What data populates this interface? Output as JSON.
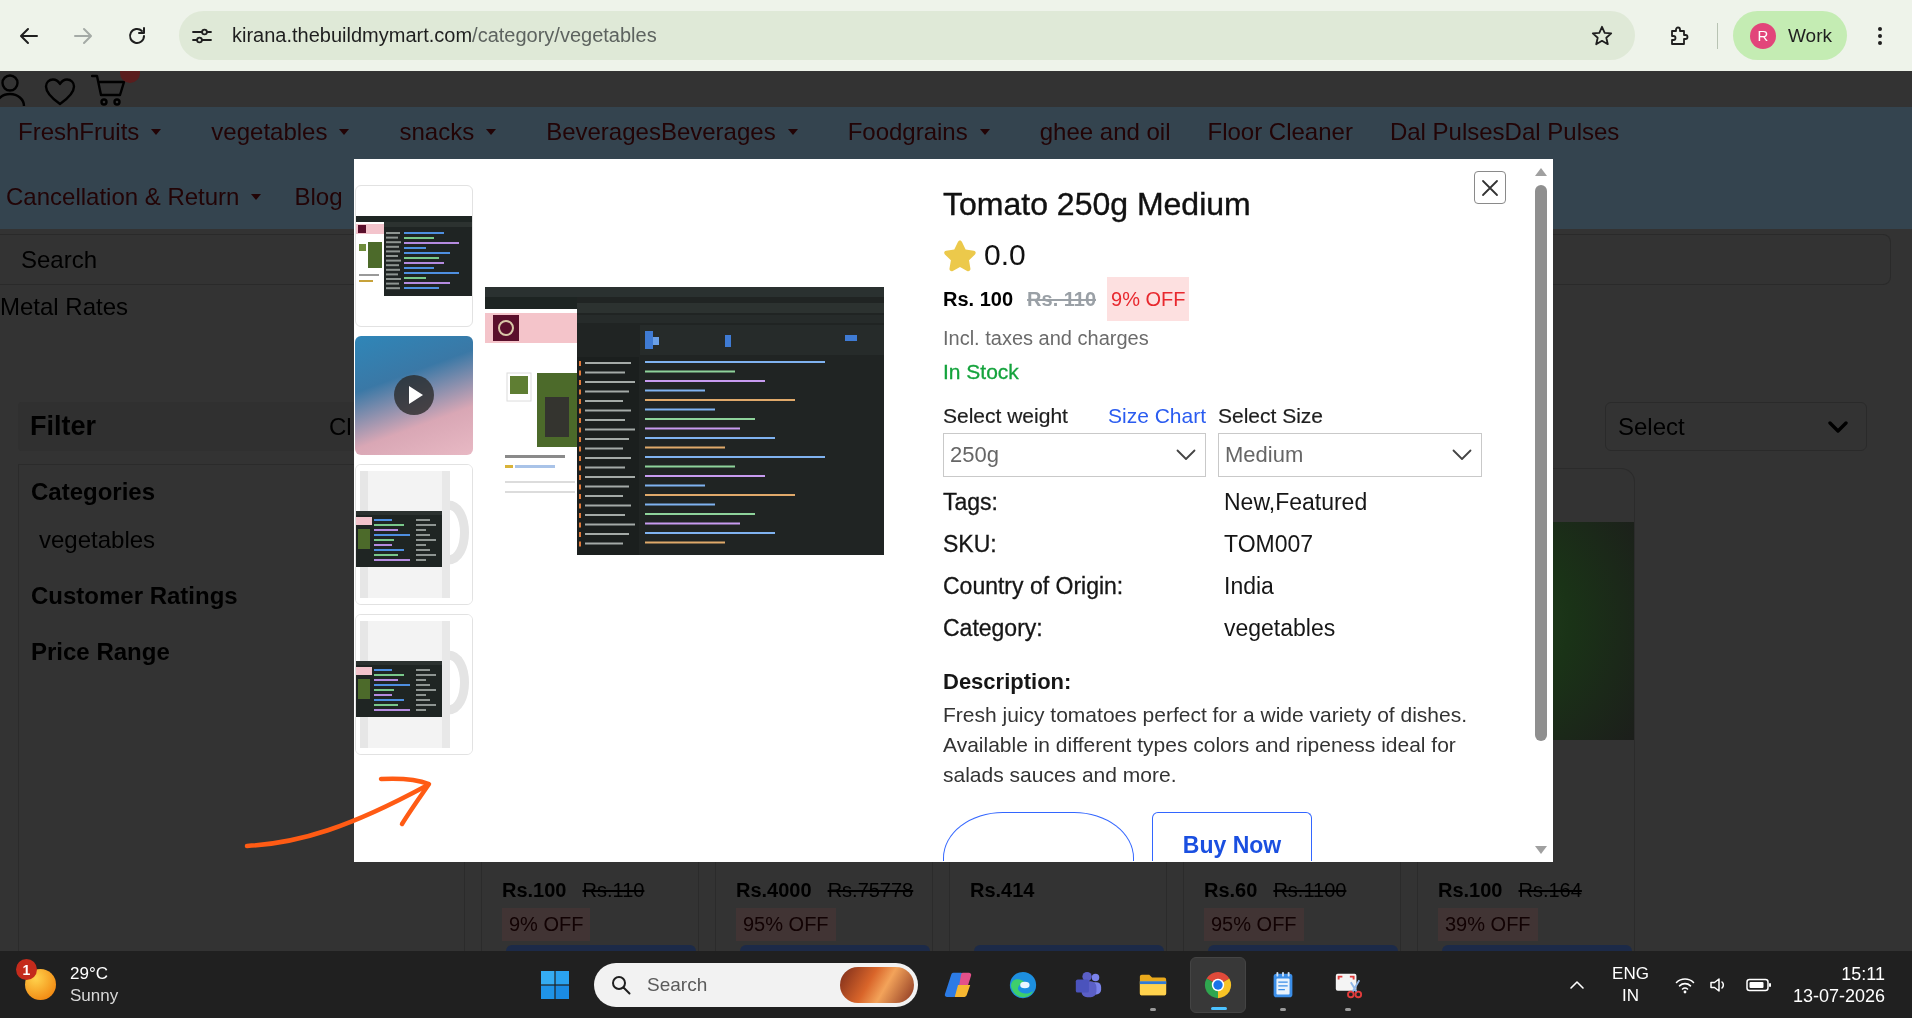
{
  "browser": {
    "nav_buttons": [
      {
        "kind": "back",
        "disabled": false
      },
      {
        "kind": "forward",
        "disabled": true
      },
      {
        "kind": "reload",
        "disabled": false
      }
    ],
    "address": {
      "host": "kirana.thebuildmymart.com",
      "path": "/category/vegetables",
      "bookmarked": false
    },
    "profile": {
      "initial": "R",
      "name": "Work"
    }
  },
  "site": {
    "header_icons": [
      {
        "kind": "user",
        "badge": false
      },
      {
        "kind": "heart",
        "badge": false
      },
      {
        "kind": "cart",
        "badge": true
      }
    ],
    "nav_rows": [
      [
        {
          "label": "FreshFruits",
          "dropdown": true
        },
        {
          "label": "vegetables",
          "dropdown": true
        },
        {
          "label": "snacks",
          "dropdown": true
        },
        {
          "label": "BeveragesBeverages",
          "dropdown": true
        },
        {
          "label": "Foodgrains",
          "dropdown": true
        },
        {
          "label": "ghee and oil",
          "dropdown": false
        },
        {
          "label": "Floor Cleaner",
          "dropdown": false
        },
        {
          "label": "Dal PulsesDal Pulses",
          "dropdown": false
        }
      ],
      [
        {
          "label": "Cancellation & Return",
          "dropdown": true
        },
        {
          "label": "Blog",
          "dropdown": false
        }
      ]
    ],
    "search": {
      "placeholder": "Search"
    },
    "metal_rates": "Metal Rates",
    "filter": {
      "title": "Filter",
      "clear": "Cl",
      "sections": [
        {
          "title": "Categories",
          "options": [
            "vegetables"
          ]
        },
        {
          "title": "Customer Ratings"
        },
        {
          "title": "Price Range"
        }
      ]
    },
    "sort": {
      "placeholder": "Select"
    },
    "products": [
      {
        "price": "Rs.100",
        "mrp": "Rs.110",
        "discount": "9% OFF"
      },
      {
        "price": "Rs.4000",
        "mrp": "Rs.75778",
        "discount": "95% OFF"
      },
      {
        "price": "Rs.414"
      },
      {
        "price": "Rs.60",
        "mrp": "Rs.1100",
        "discount": "95% OFF"
      },
      {
        "price": "Rs.100",
        "mrp": "Rs.164",
        "discount": "39% OFF",
        "photo": true
      }
    ]
  },
  "modal": {
    "thumbnails": [
      {
        "kind": "screenshot"
      },
      {
        "kind": "video"
      },
      {
        "kind": "mug"
      },
      {
        "kind": "mug"
      }
    ],
    "title": "Tomato 250g Medium",
    "rating": "0.0",
    "price": "Rs. 100",
    "mrp": "Rs. 110",
    "discount": "9% OFF",
    "tax_note": "Incl. taxes and charges",
    "stock": "In Stock",
    "in_stock": true,
    "variants": [
      {
        "label": "Select weight",
        "link": "Size Chart",
        "value": "250g"
      },
      {
        "label": "Select Size",
        "value": "Medium"
      }
    ],
    "details": [
      {
        "label": "Tags:",
        "value": "New,Featured"
      },
      {
        "label": "SKU:",
        "value": "TOM007"
      },
      {
        "label": "Country of Origin:",
        "value": "India"
      },
      {
        "label": "Category:",
        "value": "vegetables"
      }
    ],
    "description_title": "Description:",
    "description": "Fresh juicy tomatoes perfect for a wide variety of dishes. Available in different types colors and ripeness ideal for salads sauces and more.",
    "buttons": [
      {
        "kind": "pill"
      },
      {
        "kind": "outline",
        "label": "Buy Now"
      }
    ]
  },
  "taskbar": {
    "weather": {
      "badge": "1",
      "temperature": "29°C",
      "condition": "Sunny"
    },
    "search": {
      "placeholder": "Search"
    },
    "apps": [
      {
        "kind": "copilot",
        "running": false,
        "active": false
      },
      {
        "kind": "edge",
        "running": false,
        "active": false
      },
      {
        "kind": "teams",
        "running": false,
        "active": false
      },
      {
        "kind": "explorer",
        "running": true,
        "active": false
      },
      {
        "kind": "chrome",
        "running": true,
        "active": true
      },
      {
        "kind": "notepad",
        "running": true,
        "active": false
      },
      {
        "kind": "snipping",
        "running": true,
        "active": false
      }
    ],
    "language": {
      "code": "ENG",
      "region": "IN"
    },
    "clock": {
      "time": "15:11",
      "date": "13-07-2026"
    }
  }
}
